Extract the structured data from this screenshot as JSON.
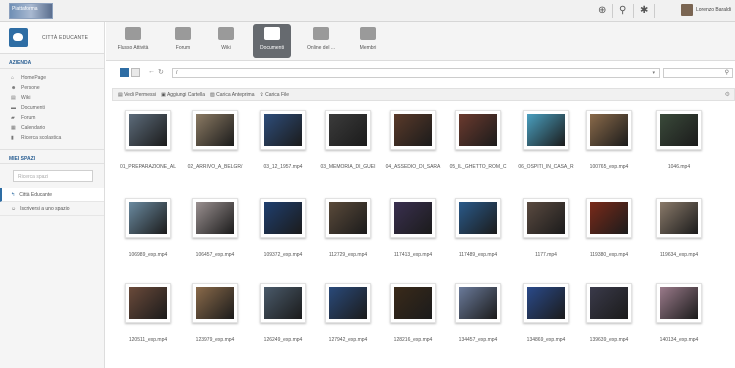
{
  "topbar": {
    "logo_text": "Piattaforma",
    "icons": [
      "add-circle-icon",
      "search-icon",
      "notification-icon"
    ],
    "user_name": "Lorenzo Baraldi"
  },
  "sidebar": {
    "space_name": "CITTÀ EDUCANTE",
    "section_title": "AZIENDA",
    "items": [
      {
        "label": "HomePage",
        "icon": "home-icon"
      },
      {
        "label": "Persone",
        "icon": "people-icon"
      },
      {
        "label": "Wiki",
        "icon": "wiki-icon"
      },
      {
        "label": "Documenti",
        "icon": "folder-icon"
      },
      {
        "label": "Forum",
        "icon": "forum-icon"
      },
      {
        "label": "Calendario",
        "icon": "calendar-icon"
      },
      {
        "label": "Ricerca scolastica",
        "icon": "document-icon"
      }
    ],
    "my_spaces_title": "MIEI SPAZI",
    "search_placeholder": "Ricerca spazi",
    "spaces": [
      {
        "label": "Città Educante",
        "icon": "space-icon"
      },
      {
        "label": "Iscriversi a uno spazio",
        "icon": "join-icon"
      }
    ]
  },
  "appbar": {
    "apps": [
      {
        "label": "Flusso Attività",
        "icon": "activity-icon"
      },
      {
        "label": "Forum",
        "icon": "forum-icon"
      },
      {
        "label": "Wiki",
        "icon": "wiki-icon"
      },
      {
        "label": "Documenti",
        "icon": "folder-icon",
        "active": true
      },
      {
        "label": "Online del ...",
        "icon": "calendar-icon"
      },
      {
        "label": "Membri",
        "icon": "members-icon"
      }
    ]
  },
  "toolbar": {
    "path_value": "/",
    "search_value": ""
  },
  "actions": [
    {
      "label": "Vedi Permessi",
      "icon": "permissions-icon"
    },
    {
      "label": "Aggiungi Cartella",
      "icon": "add-folder-icon"
    },
    {
      "label": "Carica Anteprima",
      "icon": "preview-icon"
    },
    {
      "label": "Carica File",
      "icon": "upload-icon"
    }
  ],
  "files": [
    {
      "name": "01_PREPARAZIONE_AL",
      "color": "#5c6b7a"
    },
    {
      "name": "02_ARRIVO_A_BELGR/",
      "color": "#8b7a63"
    },
    {
      "name": "03_12_1957.mp4",
      "color": "#2e4d7a"
    },
    {
      "name": "03_MEMORIA_DI_GUEI",
      "color": "#3b3b3b"
    },
    {
      "name": "04_ASSEDIO_DI_SARA",
      "color": "#5a3a2a"
    },
    {
      "name": "05_IL_GHETTO_ROM_C",
      "color": "#6b3a2e"
    },
    {
      "name": "06_OSPITI_IN_CASA_R",
      "color": "#4aa0c0"
    },
    {
      "name": "100765_exp.mp4",
      "color": "#8a6a4a"
    },
    {
      "name": "1046.mp4",
      "color": "#3a4a3a"
    },
    {
      "name": "106989_exp.mp4",
      "color": "#6a8aa0"
    },
    {
      "name": "106457_exp.mp4",
      "color": "#9a9090"
    },
    {
      "name": "109372_exp.mp4",
      "color": "#1f3f6f"
    },
    {
      "name": "112729_exp.mp4",
      "color": "#5a4a3a"
    },
    {
      "name": "117413_exp.mp4",
      "color": "#3a3050"
    },
    {
      "name": "117489_exp.mp4",
      "color": "#2a5a8a"
    },
    {
      "name": "1177.mp4",
      "color": "#5a4a40"
    },
    {
      "name": "119380_exp.mp4",
      "color": "#7a2a1a"
    },
    {
      "name": "119634_exp.mp4",
      "color": "#8a7a6a"
    },
    {
      "name": "120511_exp.mp4",
      "color": "#6a4a3a"
    },
    {
      "name": "123979_exp.mp4",
      "color": "#8a6a4a"
    },
    {
      "name": "126249_exp.mp4",
      "color": "#4a5a6a"
    },
    {
      "name": "127942_exp.mp4",
      "color": "#2a4a7a"
    },
    {
      "name": "128216_exp.mp4",
      "color": "#3a2a1a"
    },
    {
      "name": "134457_exp.mp4",
      "color": "#6a7a9a"
    },
    {
      "name": "134869_exp.mp4",
      "color": "#2a4a8a"
    },
    {
      "name": "139639_exp.mp4",
      "color": "#3a3a4a"
    },
    {
      "name": "140134_exp.mp4",
      "color": "#9a7a8a"
    }
  ]
}
